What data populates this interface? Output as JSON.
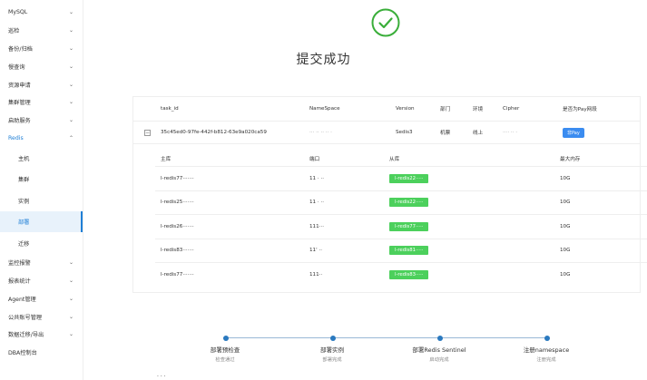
{
  "sidebar": {
    "items": [
      {
        "label": "MySQL",
        "chevron": "⌄"
      },
      {
        "label": "巡检",
        "chevron": "⌄"
      },
      {
        "label": "备份/归档",
        "chevron": "⌄"
      },
      {
        "label": "慢查询",
        "chevron": "⌄"
      },
      {
        "label": "资源申请",
        "chevron": "⌄"
      },
      {
        "label": "集群管理",
        "chevron": "⌄"
      },
      {
        "label": "启助服务",
        "chevron": "⌄"
      },
      {
        "label": "Redis",
        "chevron": "⌃"
      },
      {
        "label": "主机"
      },
      {
        "label": "集群"
      },
      {
        "label": "实例"
      },
      {
        "label": "部署"
      },
      {
        "label": "迁移"
      },
      {
        "label": "监控报警",
        "chevron": "⌄"
      },
      {
        "label": "报表统计",
        "chevron": "⌄"
      },
      {
        "label": "Agent管理",
        "chevron": "⌄"
      },
      {
        "label": "公共账号管理",
        "chevron": "⌄"
      },
      {
        "label": "数据迁移/导出",
        "chevron": "⌄"
      },
      {
        "label": "DBA控制台"
      }
    ]
  },
  "main": {
    "title": "提交成功",
    "table": {
      "headers": [
        "task_id",
        "NameSpace",
        "Version",
        "部门",
        "环境",
        "Cipher",
        "是否为Pay网段"
      ],
      "row": {
        "expand": "−",
        "task_id": "35c45ed0-97fe-442f-b812-63e9a020ca59",
        "namespace": "··· ·· ·· ·· ·",
        "version": "Sedis3",
        "dept": "机票",
        "env": "线上",
        "cipher": "···· ·· ·",
        "pay": "非Pay"
      },
      "sub_headers": [
        "主库",
        "端口",
        "从库",
        "最大内存"
      ],
      "sub_rows": [
        {
          "master": "l-redis77·······",
          "port": "11 · ··",
          "slave": "l-redis22·····",
          "mem": "10G"
        },
        {
          "master": "l-redis25·······",
          "port": "11 · ··",
          "slave": "l-redis22·····",
          "mem": "10G"
        },
        {
          "master": "l-redis26·······",
          "port": "111···",
          "slave": "l-redis77·····",
          "mem": "10G"
        },
        {
          "master": "l-redis83·······",
          "port": "11' ··",
          "slave": "l-redis81·····",
          "mem": "10G"
        },
        {
          "master": "l-redis77·······",
          "port": "111··",
          "slave": "l-redis83·····",
          "mem": "10G"
        }
      ]
    }
  },
  "steps": [
    {
      "title": "部署预检查",
      "desc": "检查通过"
    },
    {
      "title": "部署实例",
      "desc": "部署完成"
    },
    {
      "title": "部署Redis Sentinel",
      "desc": "启动完成"
    },
    {
      "title": "注册namespace",
      "desc": "注册完成"
    }
  ],
  "footer": "· · ·",
  "colors": {
    "accent": "#1f7fd6",
    "success": "#3aae3a",
    "tag_green": "#4cd05c",
    "tag_blue": "#3b8cf0"
  }
}
